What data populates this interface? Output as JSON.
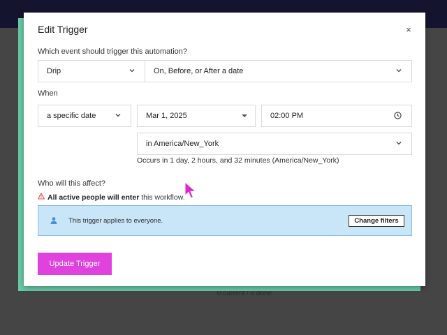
{
  "background": {
    "status_text": "0 current / 0 done"
  },
  "modal": {
    "title": "Edit Trigger",
    "close_symbol": "×",
    "event_question": "Which event should trigger this automation?",
    "event_type": {
      "value": "Drip"
    },
    "event_timing": {
      "value": "On, Before, or After a date"
    },
    "when_label": "When",
    "date_mode": {
      "value": "a specific date"
    },
    "date": {
      "value": "Mar 1, 2025"
    },
    "time": {
      "value": "02:00 PM"
    },
    "timezone": {
      "value": "in America/New_York"
    },
    "occurs_text": "Occurs in 1 day, 2 hours, and 32 minutes (America/New_York)",
    "audience_question": "Who will this affect?",
    "warning": {
      "bold": "All active people will enter",
      "rest": " this workflow."
    },
    "filter_panel": {
      "text": "This trigger applies to everyone.",
      "change_filters_label": "Change filters"
    },
    "update_label": "Update Trigger"
  },
  "colors": {
    "accent": "#e042dd",
    "panel_bg": "#c9e5f8",
    "panel_border": "#88bfe4",
    "frame": "#68cba6",
    "topbar": "#15142e",
    "warning": "#d9534f",
    "person_icon": "#4a90d9"
  },
  "icons": [
    "close-icon",
    "chevron-down-icon",
    "caret-down-icon",
    "clock-icon",
    "warning-icon",
    "person-icon",
    "mouse-cursor-icon"
  ]
}
